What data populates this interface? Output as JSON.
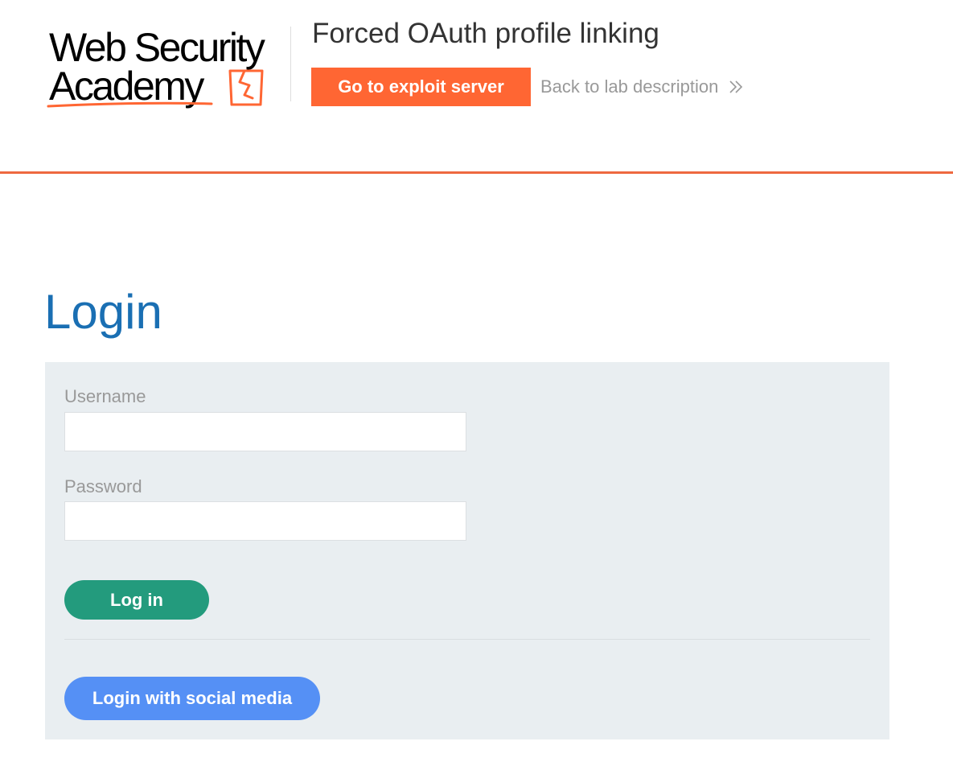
{
  "header": {
    "logo": {
      "line1": "Web Security",
      "line2": "Academy"
    },
    "lab_title": "Forced OAuth profile linking",
    "exploit_button_label": "Go to exploit server",
    "back_link_label": "Back to lab description",
    "accent_color": "#ee6940",
    "exploit_button_color": "#ff6633"
  },
  "main": {
    "heading": "Login",
    "form": {
      "username_label": "Username",
      "username_value": "",
      "password_label": "Password",
      "password_value": "",
      "login_button_label": "Log in",
      "social_button_label": "Login with social media"
    },
    "colors": {
      "heading": "#1a6fb3",
      "panel_bg": "#e9eef1",
      "login_button": "#239b7d",
      "social_button": "#5590f5"
    }
  }
}
